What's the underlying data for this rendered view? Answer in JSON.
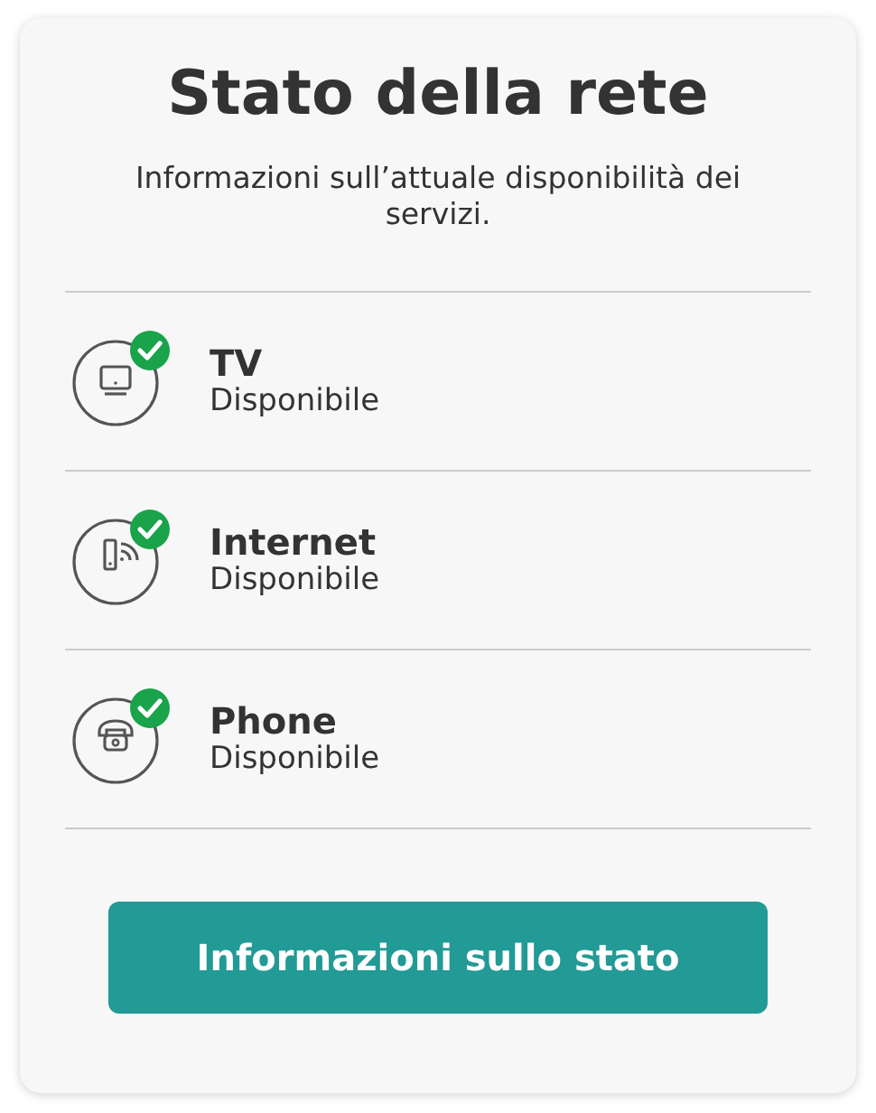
{
  "title": "Stato della rete",
  "subtitle": "Informazioni sull’attuale disponibilità dei servizi.",
  "services": [
    {
      "kind": "tv",
      "name": "TV",
      "status": "Disponibile",
      "available": true
    },
    {
      "kind": "internet",
      "name": "Internet",
      "status": "Disponibile",
      "available": true
    },
    {
      "kind": "phone",
      "name": "Phone",
      "status": "Disponibile",
      "available": true
    }
  ],
  "button": "Informazioni sullo stato"
}
